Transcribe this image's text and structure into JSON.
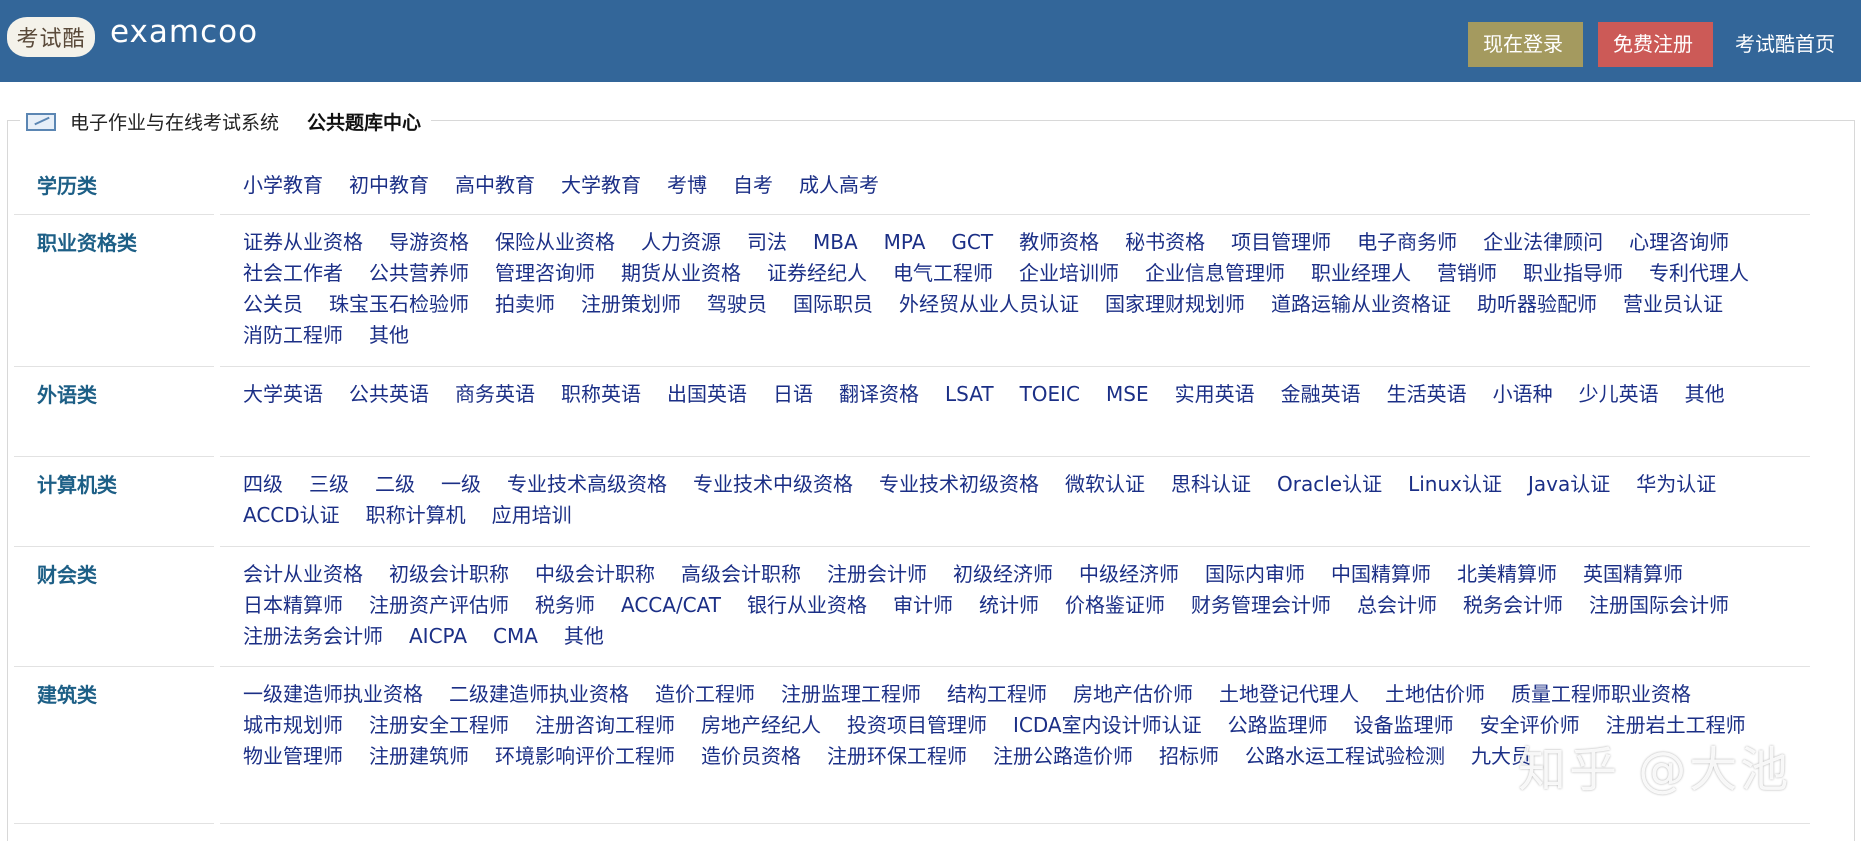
{
  "header": {
    "logo_seal_text": "考试酷",
    "logo_text": "examcoo",
    "login_label": "现在登录",
    "register_label": "免费注册",
    "home_label": "考试酷首页",
    "colors": {
      "bar": "#336699",
      "login": "#a49a5f",
      "register": "#cc5a57"
    }
  },
  "breadcrumb": {
    "icon": "edit-box-icon",
    "system": "电子作业与在线考试系统",
    "center": "公共题库中心"
  },
  "categories": [
    {
      "name": "学历类",
      "items": [
        "小学教育",
        "初中教育",
        "高中教育",
        "大学教育",
        "考博",
        "自考",
        "成人高考"
      ]
    },
    {
      "name": "职业资格类",
      "items": [
        "证券从业资格",
        "导游资格",
        "保险从业资格",
        "人力资源",
        "司法",
        "MBA",
        "MPA",
        "GCT",
        "教师资格",
        "秘书资格",
        "项目管理师",
        "电子商务师",
        "企业法律顾问",
        "心理咨询师",
        "社会工作者",
        "公共营养师",
        "管理咨询师",
        "期货从业资格",
        "证券经纪人",
        "电气工程师",
        "企业培训师",
        "企业信息管理师",
        "职业经理人",
        "营销师",
        "职业指导师",
        "专利代理人",
        "公关员",
        "珠宝玉石检验师",
        "拍卖师",
        "注册策划师",
        "驾驶员",
        "国际职员",
        "外经贸从业人员认证",
        "国家理财规划师",
        "道路运输从业资格证",
        "助听器验配师",
        "营业员认证",
        "消防工程师",
        "其他"
      ]
    },
    {
      "name": "外语类",
      "items": [
        "大学英语",
        "公共英语",
        "商务英语",
        "职称英语",
        "出国英语",
        "日语",
        "翻译资格",
        "LSAT",
        "TOEIC",
        "MSE",
        "实用英语",
        "金融英语",
        "生活英语",
        "小语种",
        "少儿英语",
        "其他"
      ]
    },
    {
      "name": "计算机类",
      "items": [
        "四级",
        "三级",
        "二级",
        "一级",
        "专业技术高级资格",
        "专业技术中级资格",
        "专业技术初级资格",
        "微软认证",
        "思科认证",
        "Oracle认证",
        "Linux认证",
        "Java认证",
        "华为认证",
        "ACCD认证",
        "职称计算机",
        "应用培训"
      ]
    },
    {
      "name": "财会类",
      "items": [
        "会计从业资格",
        "初级会计职称",
        "中级会计职称",
        "高级会计职称",
        "注册会计师",
        "初级经济师",
        "中级经济师",
        "国际内审师",
        "中国精算师",
        "北美精算师",
        "英国精算师",
        "日本精算师",
        "注册资产评估师",
        "税务师",
        "ACCA/CAT",
        "银行从业资格",
        "审计师",
        "统计师",
        "价格鉴证师",
        "财务管理会计师",
        "总会计师",
        "税务会计师",
        "注册国际会计师",
        "注册法务会计师",
        "AICPA",
        "CMA",
        "其他"
      ]
    },
    {
      "name": "建筑类",
      "items": [
        "一级建造师执业资格",
        "二级建造师执业资格",
        "造价工程师",
        "注册监理工程师",
        "结构工程师",
        "房地产估价师",
        "土地登记代理人",
        "土地估价师",
        "质量工程师职业资格",
        "城市规划师",
        "注册安全工程师",
        "注册咨询工程师",
        "房地产经纪人",
        "投资项目管理师",
        "ICDA室内设计师认证",
        "公路监理师",
        "设备监理师",
        "安全评价师",
        "注册岩土工程师",
        "物业管理师",
        "注册建筑师",
        "环境影响评价工程师",
        "造价员资格",
        "注册环保工程师",
        "注册公路造价师",
        "招标师",
        "公路水运工程试验检测",
        "九大员"
      ]
    }
  ],
  "watermark": "知乎 @大池"
}
